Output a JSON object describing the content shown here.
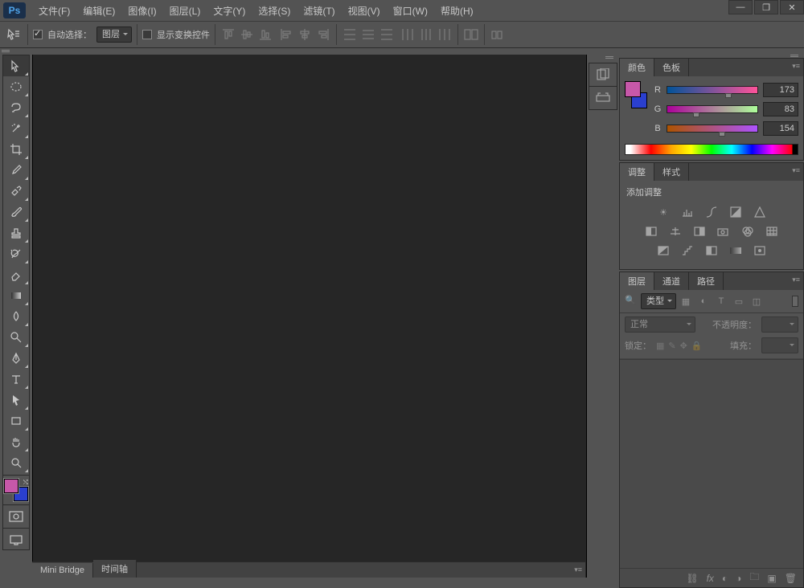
{
  "app": {
    "logo": "Ps"
  },
  "menu": [
    {
      "label": "文件(F)"
    },
    {
      "label": "编辑(E)"
    },
    {
      "label": "图像(I)"
    },
    {
      "label": "图层(L)"
    },
    {
      "label": "文字(Y)"
    },
    {
      "label": "选择(S)"
    },
    {
      "label": "滤镜(T)"
    },
    {
      "label": "视图(V)"
    },
    {
      "label": "窗口(W)"
    },
    {
      "label": "帮助(H)"
    }
  ],
  "window_controls": {
    "min": "—",
    "max": "❐",
    "close": "✕"
  },
  "options": {
    "auto_select_label": "自动选择：",
    "auto_select_checked": true,
    "auto_select_target": "图层",
    "show_transform_label": "显示变换控件",
    "show_transform_checked": false
  },
  "tools": [
    "move",
    "marquee",
    "lasso",
    "wand",
    "crop",
    "eyedropper",
    "healing",
    "brush",
    "stamp",
    "history",
    "eraser",
    "gradient",
    "blur",
    "dodge",
    "pen",
    "type",
    "path-sel",
    "rectangle",
    "hand",
    "zoom"
  ],
  "swatch": {
    "fg": "#c758a9",
    "bg": "#2a3fcf"
  },
  "panels": {
    "color": {
      "tab_color": "颜色",
      "tab_swatch": "色板",
      "channels": [
        {
          "name": "R",
          "value": "173",
          "pct": 67.8,
          "grad": "linear-gradient(to right,#005399,#ff539a)"
        },
        {
          "name": "G",
          "value": "83",
          "pct": 32.5,
          "grad": "linear-gradient(to right,#ad009a,#adff9a)"
        },
        {
          "name": "B",
          "value": "154",
          "pct": 60.4,
          "grad": "linear-gradient(to right,#ad5300,#ad53ff)"
        }
      ]
    },
    "adjust": {
      "tab_adjust": "调整",
      "tab_style": "样式",
      "title": "添加调整"
    },
    "layers": {
      "tab_layers": "图层",
      "tab_channels": "通道",
      "tab_paths": "路径",
      "kind": "类型",
      "blend": "正常",
      "opacity_label": "不透明度：",
      "lock_label": "锁定：",
      "fill_label": "填充："
    }
  },
  "bottom_tabs": [
    {
      "label": "Mini Bridge",
      "active": true
    },
    {
      "label": "时间轴",
      "active": false
    }
  ]
}
